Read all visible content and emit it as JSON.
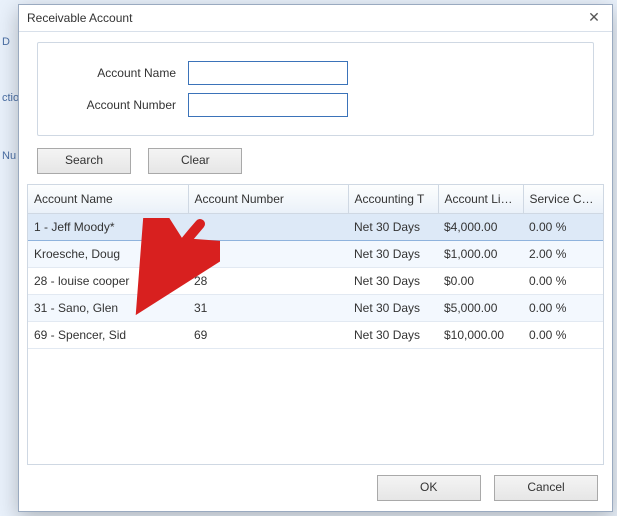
{
  "bg": {
    "a": "D",
    "b": "ctio",
    "c": "Nu"
  },
  "dialog": {
    "title": "Receivable Account",
    "close_glyph": "✕"
  },
  "form": {
    "name_label": "Account Name",
    "name_value": "",
    "number_label": "Account Number",
    "number_value": ""
  },
  "buttons": {
    "search": "Search",
    "clear": "Clear",
    "ok": "OK",
    "cancel": "Cancel"
  },
  "grid": {
    "columns": {
      "name": "Account Name",
      "number": "Account Number",
      "terms": "Accounting T",
      "limit": "Account Limit",
      "service": "Service Charg"
    },
    "colwidths": {
      "name": "160",
      "number": "160",
      "terms": "90",
      "limit": "85",
      "service": "82"
    },
    "rows": [
      {
        "name": "1 - Jeff Moody*",
        "number": "1",
        "terms": "Net 30 Days",
        "limit": "$4,000.00",
        "service": "0.00 %",
        "selected": true
      },
      {
        "name": "Kroesche, Doug",
        "number": "",
        "terms": "Net 30 Days",
        "limit": "$1,000.00",
        "service": "2.00 %",
        "selected": false
      },
      {
        "name": "28 - louise cooper",
        "number": "28",
        "terms": "Net 30 Days",
        "limit": "$0.00",
        "service": "0.00 %",
        "selected": false
      },
      {
        "name": "31 - Sano, Glen",
        "number": "31",
        "terms": "Net 30 Days",
        "limit": "$5,000.00",
        "service": "0.00 %",
        "selected": false
      },
      {
        "name": "69 - Spencer, Sid",
        "number": "69",
        "terms": "Net 30 Days",
        "limit": "$10,000.00",
        "service": "0.00 %",
        "selected": false
      }
    ]
  },
  "annotation": {
    "points_to_row_index": 3
  }
}
